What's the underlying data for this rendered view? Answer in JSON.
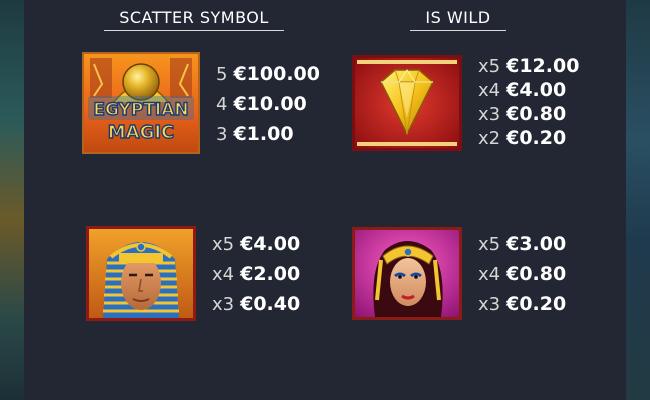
{
  "headings": {
    "scatter": "SCATTER SYMBOL",
    "wild": "IS WILD"
  },
  "symbols": {
    "egypt": {
      "icon": "egyptian-magic-scatter-icon",
      "logo_line1": "EGYPTIAN",
      "logo_line2": "MAGIC",
      "pays": [
        {
          "mult": "5",
          "amount": "€100.00"
        },
        {
          "mult": "4",
          "amount": "€10.00"
        },
        {
          "mult": "3",
          "amount": "€1.00"
        }
      ]
    },
    "diamond": {
      "icon": "yellow-diamond-wild-icon",
      "pays": [
        {
          "mult": "x5",
          "amount": "€12.00"
        },
        {
          "mult": "x4",
          "amount": "€4.00"
        },
        {
          "mult": "x3",
          "amount": "€0.80"
        },
        {
          "mult": "x2",
          "amount": "€0.20"
        }
      ]
    },
    "pharaoh": {
      "icon": "pharaoh-icon",
      "pays": [
        {
          "mult": "x5",
          "amount": "€4.00"
        },
        {
          "mult": "x4",
          "amount": "€2.00"
        },
        {
          "mult": "x3",
          "amount": "€0.40"
        }
      ]
    },
    "queen": {
      "icon": "egyptian-queen-icon",
      "pays": [
        {
          "mult": "x5",
          "amount": "€3.00"
        },
        {
          "mult": "x4",
          "amount": "€0.80"
        },
        {
          "mult": "x3",
          "amount": "€0.20"
        }
      ]
    }
  },
  "colors": {
    "panel": "#222733",
    "text": "#ffffff",
    "gold": "#f2c531"
  }
}
